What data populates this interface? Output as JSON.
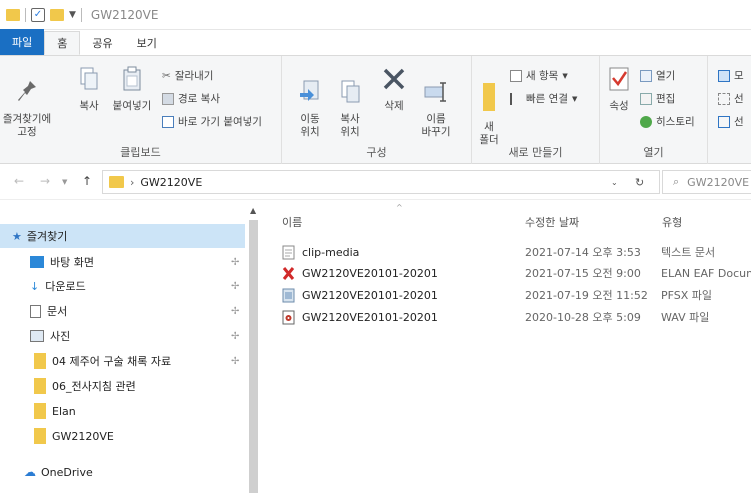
{
  "window": {
    "title": "GW2120VE"
  },
  "tabs": [
    {
      "label": "파일"
    },
    {
      "label": "홈"
    },
    {
      "label": "공유"
    },
    {
      "label": "보기"
    }
  ],
  "ribbon": {
    "clipboard": {
      "group_label": "클립보드",
      "pin_label": "즐겨찾기에\n고정",
      "copy_label": "복사",
      "paste_label": "붙여넣기",
      "cut_label": "잘라내기",
      "copy_path_label": "경로 복사",
      "paste_shortcut_label": "바로 가기 붙여넣기"
    },
    "organize": {
      "group_label": "구성",
      "move_label": "이동\n위치",
      "copyto_label": "복사\n위치",
      "delete_label": "삭제",
      "rename_label": "이름\n바꾸기"
    },
    "new": {
      "group_label": "새로 만들기",
      "new_folder_label": "새\n폴더",
      "new_item_label": "새 항목",
      "easy_access_label": "빠른 연결"
    },
    "open": {
      "group_label": "열기",
      "properties_label": "속성",
      "open_label": "열기",
      "edit_label": "편집",
      "history_label": "히스토리"
    },
    "select": {
      "select_all_label": "모",
      "select_none_label": "선",
      "invert_label": "선"
    }
  },
  "address": {
    "path_item": "GW2120VE",
    "search_placeholder": "GW2120VE"
  },
  "nav": {
    "quick_access_label": "즐겨찾기",
    "items": [
      {
        "label": "바탕 화면",
        "pinned": true
      },
      {
        "label": "다운로드",
        "pinned": true
      },
      {
        "label": "문서",
        "pinned": true
      },
      {
        "label": "사진",
        "pinned": true
      },
      {
        "label": "04 제주어 구술 채록 자료",
        "pinned": true
      },
      {
        "label": "06_전사지침 관련",
        "pinned": false
      },
      {
        "label": "Elan",
        "pinned": false
      },
      {
        "label": "GW2120VE",
        "pinned": false
      }
    ],
    "onedrive_label": "OneDrive"
  },
  "content": {
    "columns": {
      "name": "이름",
      "date": "수정한 날짜",
      "type": "유형"
    },
    "files": [
      {
        "name": "clip-media",
        "date": "2021-07-14 오후 3:53",
        "type": "텍스트 문서",
        "icon": "text-file-icon"
      },
      {
        "name": "GW2120VE20101-20201",
        "date": "2021-07-15 오전 9:00",
        "type": "ELAN EAF Docum",
        "icon": "elan-file-icon"
      },
      {
        "name": "GW2120VE20101-20201",
        "date": "2021-07-19 오전 11:52",
        "type": "PFSX 파일",
        "icon": "pfsx-file-icon"
      },
      {
        "name": "GW2120VE20101-20201",
        "date": "2020-10-28 오후 5:09",
        "type": "WAV 파일",
        "icon": "wav-file-icon"
      }
    ]
  },
  "colors": {
    "file_tab": "#1a6fc3",
    "selection": "#cce4f7",
    "folder": "#f1c84b"
  }
}
